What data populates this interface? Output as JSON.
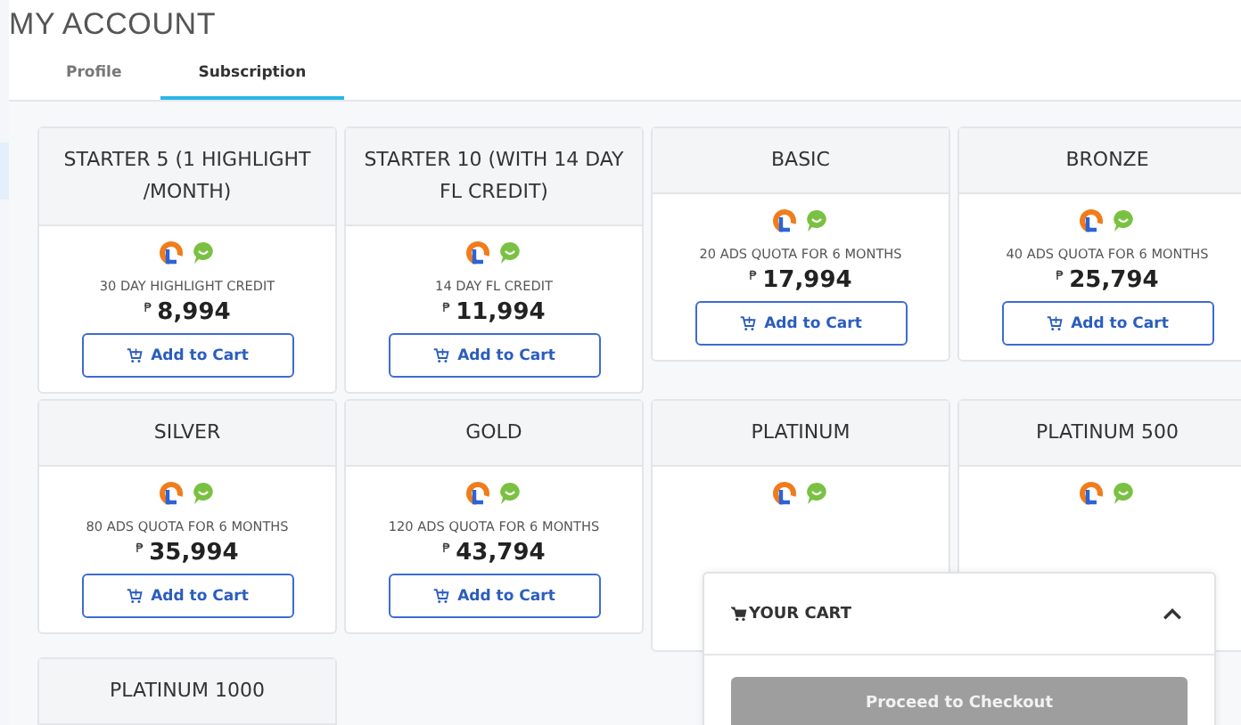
{
  "title": "MY ACCOUNT",
  "tabs": [
    {
      "label": "Profile",
      "selected": false
    },
    {
      "label": "Subscription",
      "selected": true
    }
  ],
  "plans": [
    {
      "name": "STARTER 5 (1 HIGHLIGHT /MONTH)",
      "description": "30 DAY HIGHLIGHT CREDIT",
      "currency": "₱",
      "price": "8,994",
      "button": "Add to Cart"
    },
    {
      "name": "STARTER 10 (WITH 14 DAY FL CREDIT)",
      "description": "14 DAY FL CREDIT",
      "currency": "₱",
      "price": "11,994",
      "button": "Add to Cart"
    },
    {
      "name": "BASIC",
      "description": "20 ADS QUOTA FOR 6 MONTHS",
      "currency": "₱",
      "price": "17,994",
      "button": "Add to Cart"
    },
    {
      "name": "BRONZE",
      "description": "40 ADS QUOTA FOR 6 MONTHS",
      "currency": "₱",
      "price": "25,794",
      "button": "Add to Cart"
    },
    {
      "name": "SILVER",
      "description": "80 ADS QUOTA FOR 6 MONTHS",
      "currency": "₱",
      "price": "35,994",
      "button": "Add to Cart"
    },
    {
      "name": "GOLD",
      "description": "120 ADS QUOTA FOR 6 MONTHS",
      "currency": "₱",
      "price": "43,794",
      "button": "Add to Cart"
    },
    {
      "name": "PLATINUM"
    },
    {
      "name": "PLATINUM 500"
    },
    {
      "name": "PLATINUM 1000"
    }
  ],
  "cart": {
    "title": "YOUR CART",
    "expanded": true,
    "button": {
      "label": "Proceed to Checkout",
      "disabled": true
    }
  }
}
